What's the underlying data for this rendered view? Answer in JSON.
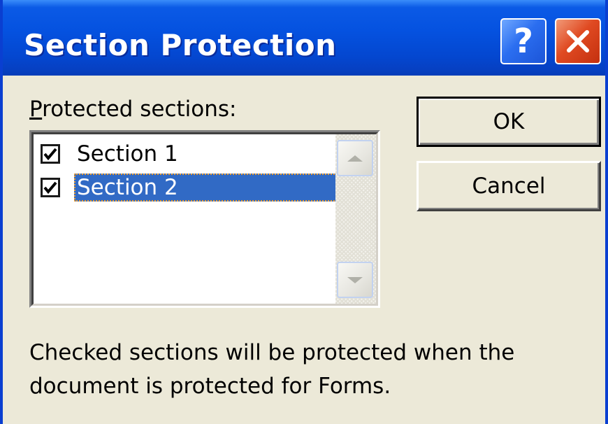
{
  "window": {
    "title": "Section Protection",
    "help_symbol": "?",
    "close_icon": "close-x-icon",
    "title_bar_color": "#0552e0"
  },
  "list": {
    "label_accel": "P",
    "label_rest": "rotected sections:",
    "items": [
      {
        "label": "Section 1",
        "checked": true,
        "selected": false
      },
      {
        "label": "Section 2",
        "checked": true,
        "selected": true
      }
    ],
    "selection_color": "#316ac5"
  },
  "buttons": {
    "ok_label": "OK",
    "cancel_label": "Cancel"
  },
  "description": {
    "line1": "Checked sections will be protected when the",
    "line2": "document is protected for Forms."
  }
}
